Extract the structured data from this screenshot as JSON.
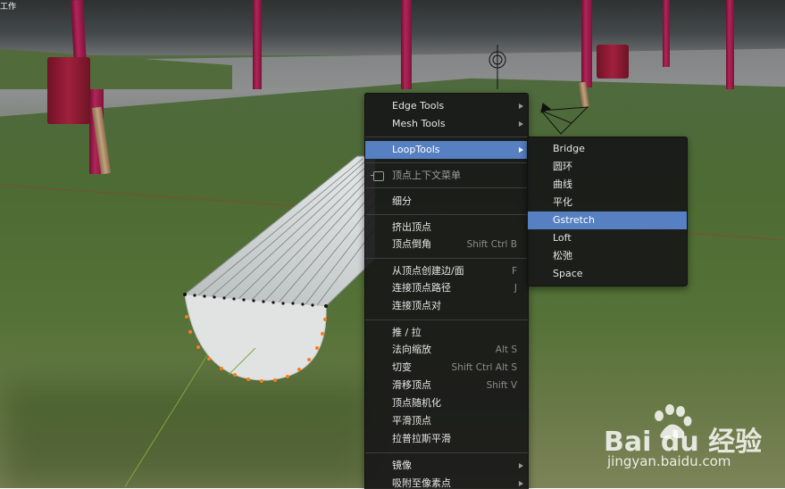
{
  "corner_label": "工作",
  "main_menu": {
    "items": [
      {
        "label": "Edge Tools",
        "shortcut": "",
        "submenu": true
      },
      {
        "label": "Mesh Tools",
        "shortcut": "",
        "submenu": true
      },
      {
        "label": "LoopTools",
        "shortcut": "",
        "submenu": true,
        "active": true
      },
      {
        "label": "顶点上下文菜单",
        "shortcut": "",
        "submenu": false,
        "pinned": true
      },
      {
        "label": "细分",
        "shortcut": "",
        "submenu": false
      },
      {
        "label": "挤出顶点",
        "shortcut": "",
        "submenu": false
      },
      {
        "label": "顶点倒角",
        "shortcut": "Shift Ctrl B",
        "submenu": false
      },
      {
        "label": "从顶点创建边/面",
        "shortcut": "F",
        "submenu": false
      },
      {
        "label": "连接顶点路径",
        "shortcut": "J",
        "submenu": false
      },
      {
        "label": "连接顶点对",
        "shortcut": "",
        "submenu": false
      },
      {
        "label": "推 / 拉",
        "shortcut": "",
        "submenu": false
      },
      {
        "label": "法向缩放",
        "shortcut": "Alt S",
        "submenu": false
      },
      {
        "label": "切变",
        "shortcut": "Shift Ctrl Alt S",
        "submenu": false
      },
      {
        "label": "滑移顶点",
        "shortcut": "Shift V",
        "submenu": false
      },
      {
        "label": "顶点随机化",
        "shortcut": "",
        "submenu": false
      },
      {
        "label": "平滑顶点",
        "shortcut": "",
        "submenu": false
      },
      {
        "label": "拉普拉斯平滑",
        "shortcut": "",
        "submenu": false
      },
      {
        "label": "镜像",
        "shortcut": "",
        "submenu": true
      },
      {
        "label": "吸附至像素点",
        "shortcut": "",
        "submenu": true
      }
    ]
  },
  "loop_tools_submenu": {
    "items": [
      {
        "label": "Bridge"
      },
      {
        "label": "圆环"
      },
      {
        "label": "曲线"
      },
      {
        "label": "平化"
      },
      {
        "label": "Gstretch",
        "active": true
      },
      {
        "label": "Loft"
      },
      {
        "label": "松弛"
      },
      {
        "label": "Space"
      }
    ]
  },
  "watermark": {
    "brand": "Bai du 经验",
    "url": "jingyan.baidu.com"
  },
  "colors": {
    "highlight": "#5680c2",
    "menu_bg": "#181818",
    "selected_vertex": "#ff7a1a"
  }
}
